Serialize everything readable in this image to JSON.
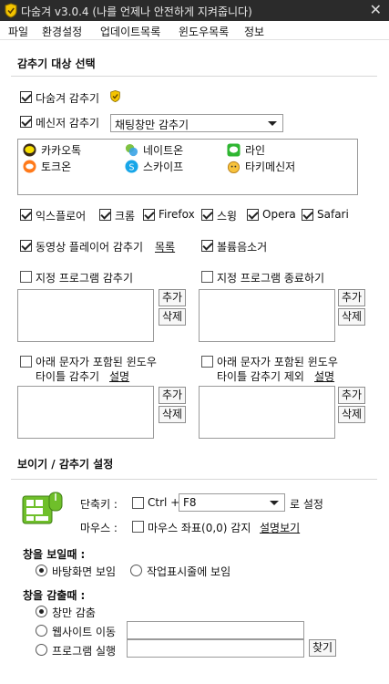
{
  "window": {
    "title": "다숨겨 v3.0.4 (나를 언제나 안전하게 지켜줍니다)",
    "close_glyph": "✕"
  },
  "menu": [
    "파일",
    "환경설정",
    "업데이트목록",
    "윈도우목록",
    "정보"
  ],
  "hide_target": {
    "section_title": "감추기 대상 선택",
    "hide_all_label": "다숨겨 감추기",
    "messenger_label": "메신저 감추기",
    "messenger_mode": "채팅창만 감추기",
    "messengers": [
      {
        "name": "카카오톡",
        "icon": "kakaotalk-icon"
      },
      {
        "name": "네이트온",
        "icon": "nateon-icon"
      },
      {
        "name": "라인",
        "icon": "line-icon"
      },
      {
        "name": "토크온",
        "icon": "talkon-icon"
      },
      {
        "name": "스카이프",
        "icon": "skype-icon"
      },
      {
        "name": "타키메신저",
        "icon": "taki-icon"
      }
    ],
    "browsers": [
      "익스플로어",
      "크롬",
      "Firefox",
      "스윙",
      "Opera",
      "Safari"
    ],
    "video_label": "동영상 플레이어 감추기",
    "video_link": "목록",
    "mute_label": "볼륨음소거",
    "hide_program_label": "지정 프로그램 감추기",
    "kill_program_label": "지정 프로그램 종료하기",
    "add_label": "추가",
    "delete_label": "삭제",
    "title_hide_line1": "아래 문자가 포함된 윈도우",
    "title_hide_line2": "타이틀 감추기",
    "title_exclude_line1": "아래 문자가 포함된 윈도우",
    "title_exclude_line2": "타이틀 감추기 제외",
    "explain_link": "설명"
  },
  "display": {
    "section_title": "보이기 / 감추기 설정",
    "hotkey_label": "단축키 :",
    "hotkey_ctrl": "Ctrl +",
    "hotkey_key": "F8",
    "hotkey_suffix": "로 설정",
    "mouse_label": "마우스 :",
    "mouse_option": "마우스 좌표(0,0) 감지",
    "mouse_link": "설명보기",
    "show_heading": "창을 보일때 :",
    "show_desktop": "바탕화면 보임",
    "show_taskbar": "작업표시줄에 보임",
    "hide_heading": "창을 감출때 :",
    "hide_window_only": "창만 감춤",
    "hide_website": "웹사이트 이동",
    "hide_run_program": "프로그램 실행",
    "browse_label": "찾기"
  }
}
